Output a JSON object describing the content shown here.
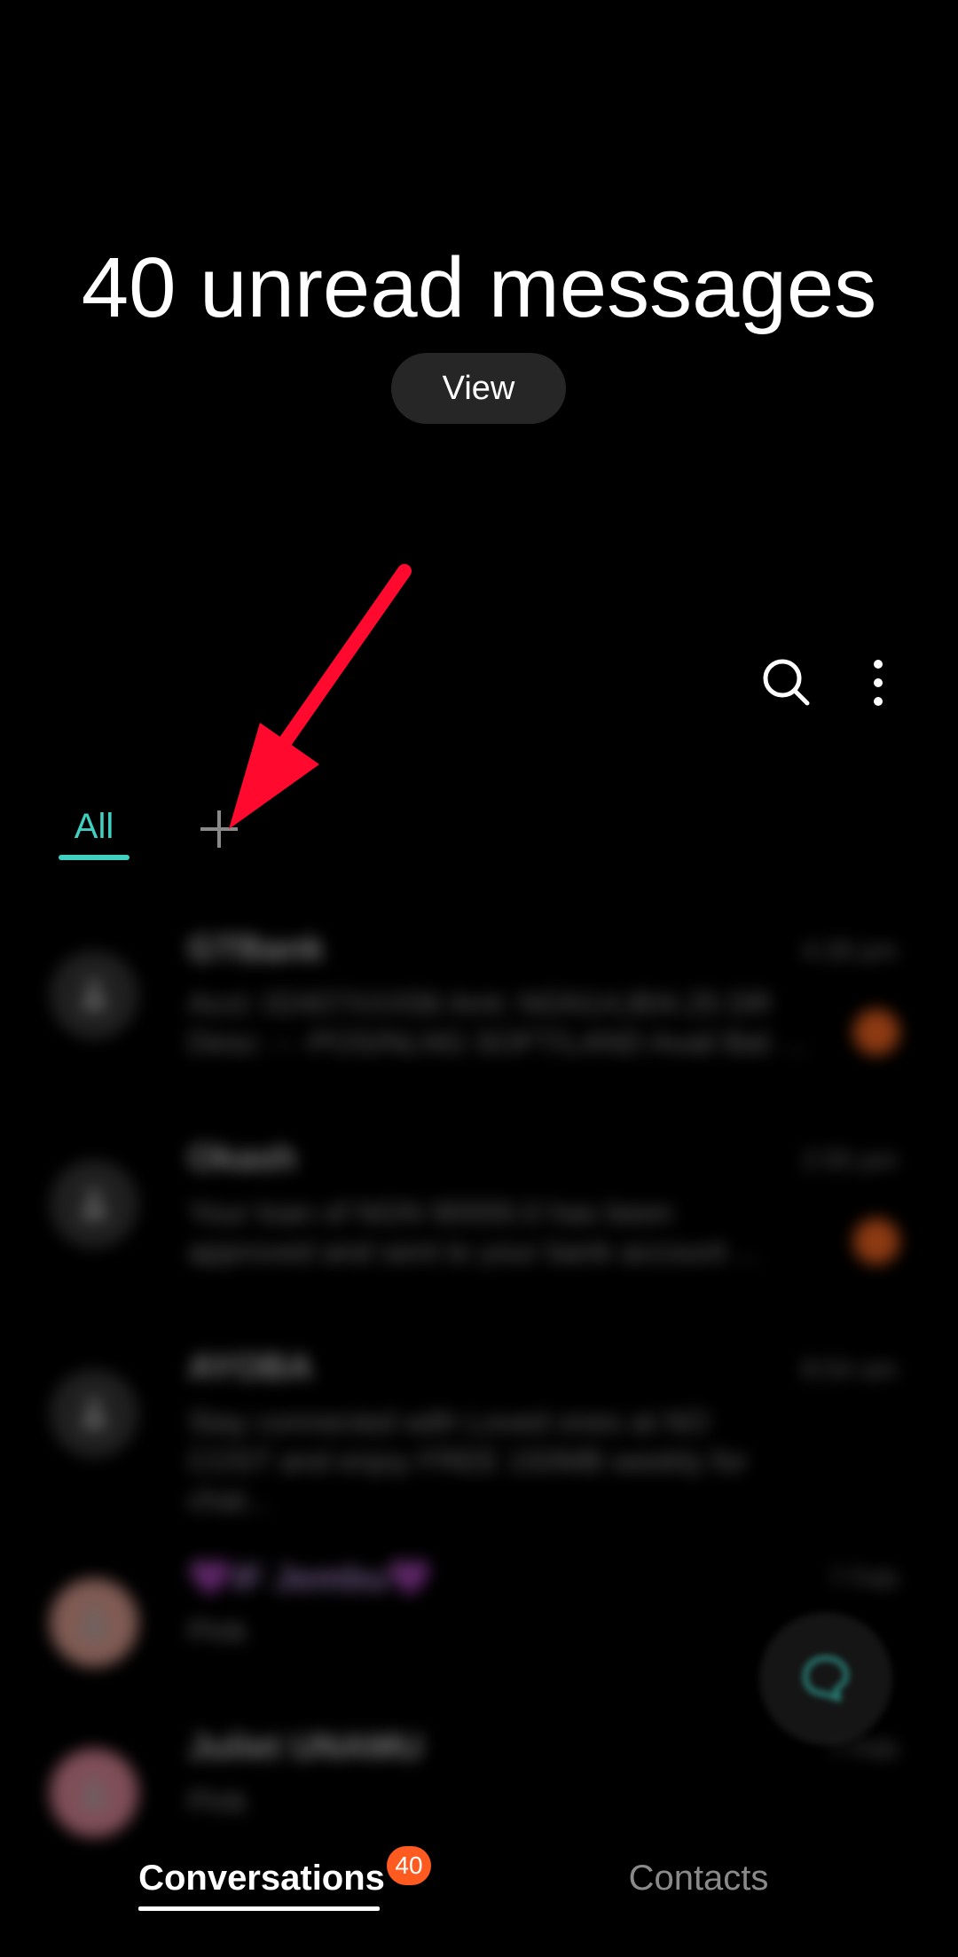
{
  "header": {
    "title": "40 unread messages",
    "view_label": "View"
  },
  "toolbar": {
    "search_icon": "search-icon",
    "more_icon": "more-vert-icon"
  },
  "tabs": {
    "active_label": "All",
    "add_icon": "plus-icon",
    "accent_color": "#3fd0c2"
  },
  "conversations": [
    {
      "name": "GTBank",
      "time": "4:28 pm",
      "preview": "Acct: 02407XXX56 Amt: NGN14,804.25 DR\nDesc: -: -POS/NLNG SOFT/LAND Avail Bal: ...",
      "unread": true,
      "avatar": "person-icon"
    },
    {
      "name": "Okash",
      "time": "2:55 pm",
      "preview": "Your loan of NGN 90000.0 has been\napproved and sent to your bank account ...",
      "unread": true,
      "avatar": "person-icon"
    },
    {
      "name": "AYOBA",
      "time": "8:54 am",
      "preview": "Stay connected with Loved ones at NO\nCOST and enjoy FREE 150MB weekly for chat...",
      "unread": false,
      "avatar": "person-icon"
    },
    {
      "name": "💜IF Jembu💜",
      "time": "7 Feb",
      "preview": "Pink",
      "unread": false,
      "avatar": "person-icon"
    },
    {
      "name": "Juliet UNAMU",
      "time": "7 Feb",
      "preview": "Pink",
      "unread": false,
      "avatar": "person-icon"
    }
  ],
  "fab": {
    "icon": "new-chat-icon"
  },
  "bottom_nav": {
    "conversations_label": "Conversations",
    "badge_count": "40",
    "contacts_label": "Contacts",
    "badge_color": "#ff5a1f"
  },
  "annotation": {
    "arrow_color": "#ff0a2e"
  }
}
